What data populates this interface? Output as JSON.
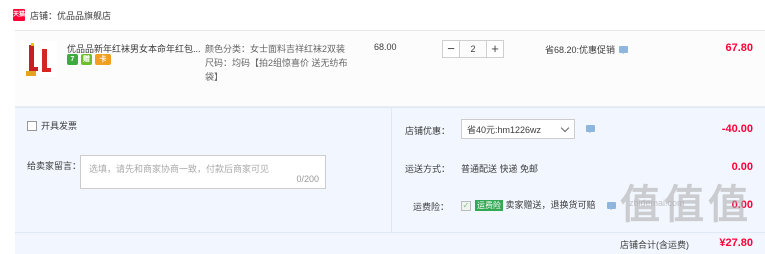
{
  "shop": {
    "badge": "天猫",
    "label": "店铺：优品品旗舰店"
  },
  "item": {
    "title": "优品品新年红袜男女本命年红包...",
    "badges": [
      "7",
      "赠",
      "卡"
    ],
    "sku_color": "颜色分类：女士面料吉祥红袜2双装",
    "sku_size": "尺码：均码【拍2组惊喜价 送无纺布袋】",
    "unit_price": "68.00",
    "quantity": "2",
    "qty_minus": "−",
    "qty_plus": "+",
    "promo": "省68.20:优惠促销",
    "total": "67.80"
  },
  "invoice": {
    "label": "开具发票"
  },
  "message": {
    "label": "给卖家留言：",
    "placeholder": "选填，请先和商家协商一致，付款后商家可见",
    "counter": "0/200"
  },
  "store_coupon": {
    "label": "店铺优惠：",
    "selected": "省40元:hm1226wz",
    "amount": "-40.00"
  },
  "shipping": {
    "label": "运送方式：",
    "value": "普通配送 快递 免邮",
    "amount": "0.00"
  },
  "freight_insurance": {
    "label": "运费险：",
    "tag": "运费险",
    "desc": "卖家赠送，退换货可赔",
    "amount": "0.00"
  },
  "store_total": {
    "label": "店铺合计(含运费)",
    "amount": "¥27.80"
  },
  "watermark": {
    "big": "值值值",
    "small": "zhidemai.com"
  },
  "colors": {
    "accent": "#ff0036",
    "panel": "#f2f7ff"
  }
}
